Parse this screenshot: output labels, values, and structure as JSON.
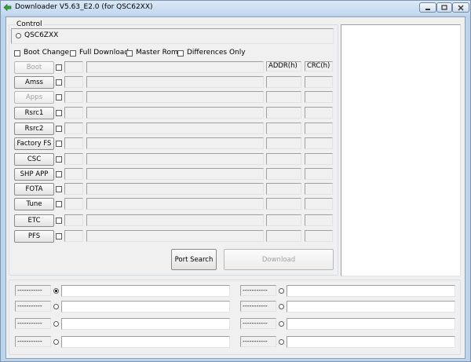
{
  "window": {
    "title": "Downloader V5.63_E2.0 (for QSC62XX)"
  },
  "control": {
    "group_title": "Control",
    "model_option": "QSC6ZXX",
    "checkboxes": [
      {
        "label": "Boot Change"
      },
      {
        "label": "Full Download"
      },
      {
        "label": "Master Rom"
      },
      {
        "label": "Differences Only"
      }
    ],
    "col_addr": "ADDR(h)",
    "col_crc": "CRC(h)",
    "images": [
      {
        "label": "Boot",
        "enabled": false
      },
      {
        "label": "Amss",
        "enabled": true
      },
      {
        "label": "Apps",
        "enabled": false
      },
      {
        "label": "Rsrc1",
        "enabled": true
      },
      {
        "label": "Rsrc2",
        "enabled": true
      },
      {
        "label": "Factory FS",
        "enabled": true
      },
      {
        "label": "CSC",
        "enabled": true
      },
      {
        "label": "SHP APP",
        "enabled": true
      },
      {
        "label": "FOTA",
        "enabled": true
      },
      {
        "label": "Tune",
        "enabled": true
      },
      {
        "label": "ETC",
        "enabled": true
      },
      {
        "label": "PFS",
        "enabled": true
      }
    ],
    "port_search_label": "Port Search",
    "download_label": "Download"
  },
  "ports": {
    "left": [
      {
        "status": "-----------",
        "selected": true
      },
      {
        "status": "-----------",
        "selected": false
      },
      {
        "status": "-----------",
        "selected": false
      },
      {
        "status": "-----------",
        "selected": false
      }
    ],
    "right": [
      {
        "status": "-----------",
        "selected": false
      },
      {
        "status": "-----------",
        "selected": false
      },
      {
        "status": "-----------",
        "selected": false
      },
      {
        "status": "-----------",
        "selected": false
      }
    ]
  }
}
